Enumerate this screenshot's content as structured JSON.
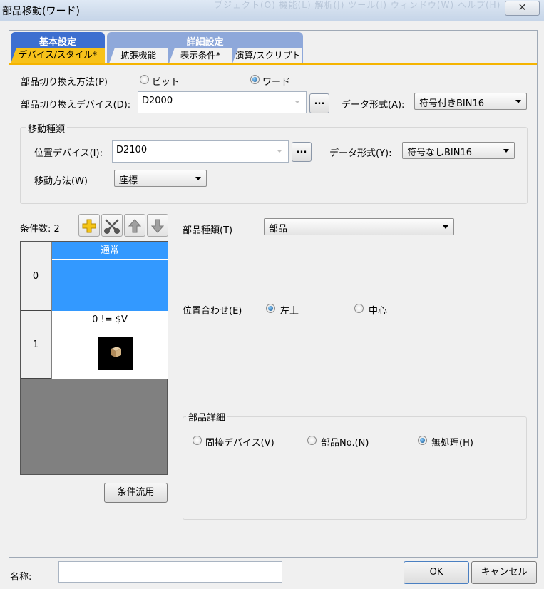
{
  "window": {
    "title": "部品移動(ワード)",
    "close_glyph": "✕",
    "ghost_text": "ブジェクト(O)  機能(L)  解析(J)  ツール(I)  ウィンドウ(W)  ヘルプ(H)"
  },
  "tabs": {
    "basic_group": "基本設定",
    "detail_group": "詳細設定",
    "device_style": "デバイス/スタイル*",
    "extension": "拡張機能",
    "display_condition": "表示条件*",
    "calc_script": "演算/スクリプト"
  },
  "switch": {
    "method_label": "部品切り換え方法(P)",
    "bit_label": "ビット",
    "word_label": "ワード",
    "selected": "word",
    "device_label": "部品切り換えデバイス(D):",
    "device_value": "D2000",
    "browse_label": "...",
    "format_label": "データ形式(A):",
    "format_value": "符号付きBIN16"
  },
  "movement": {
    "group_title": "移動種類",
    "position_label": "位置デバイス(I):",
    "position_value": "D2100",
    "browse_label": "...",
    "format_label": "データ形式(Y):",
    "format_value": "符号なしBIN16",
    "method_label": "移動方法(W)",
    "method_value": "座標"
  },
  "conditions": {
    "count_label": "条件数: 2",
    "rows": [
      {
        "index": "0",
        "header": "通常"
      },
      {
        "index": "1",
        "header": "0 != $V"
      }
    ],
    "copy_button": "条件流用"
  },
  "part": {
    "type_label": "部品種類(T)",
    "type_value": "部品",
    "align_label": "位置合わせ(E)",
    "align_top_left": "左上",
    "align_center": "中心",
    "align_selected": "top_left"
  },
  "detail": {
    "group_title": "部品詳細",
    "indirect_label": "間接デバイス(V)",
    "partno_label": "部品No.(N)",
    "none_label": "無処理(H)",
    "selected": "none"
  },
  "footer": {
    "name_label": "名称:",
    "name_value": "",
    "ok_label": "OK",
    "cancel_label": "キャンセル"
  },
  "colors": {
    "active_tab": "#f7c21a",
    "basic_group": "#3d6fd0",
    "detail_group": "#8ea8da",
    "selected_row": "#3399ff"
  }
}
